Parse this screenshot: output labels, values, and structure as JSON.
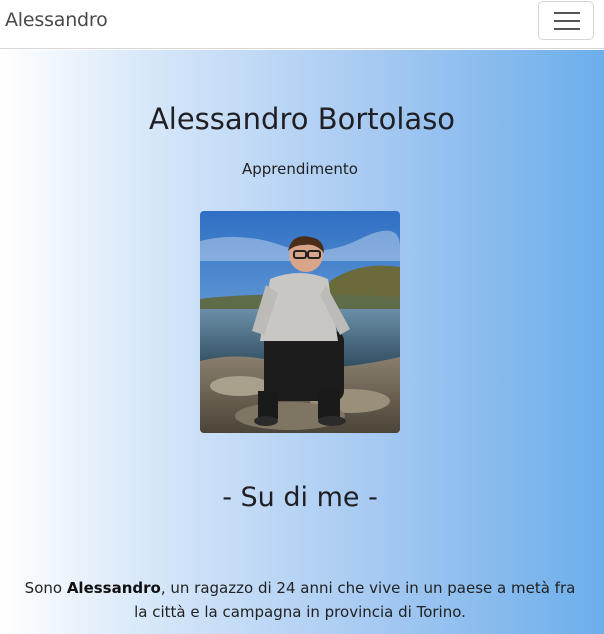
{
  "navbar": {
    "brand": "Alessandro",
    "menu_icon": "hamburger-menu-icon"
  },
  "hero": {
    "name": "Alessandro Bortolaso",
    "subtitle": "Apprendimento",
    "photo_description": "portrait-photo"
  },
  "about": {
    "title": "- Su di me -",
    "intro": "Sono ",
    "name_bold": "Alessandro",
    "text_rest": ", un ragazzo di 24 anni che vive in un paese a metà fra la città e la campagna in provincia di Torino."
  },
  "colors": {
    "gradient_start": "#ffffff",
    "gradient_end": "#6caeeb",
    "text": "#1f1f24"
  }
}
